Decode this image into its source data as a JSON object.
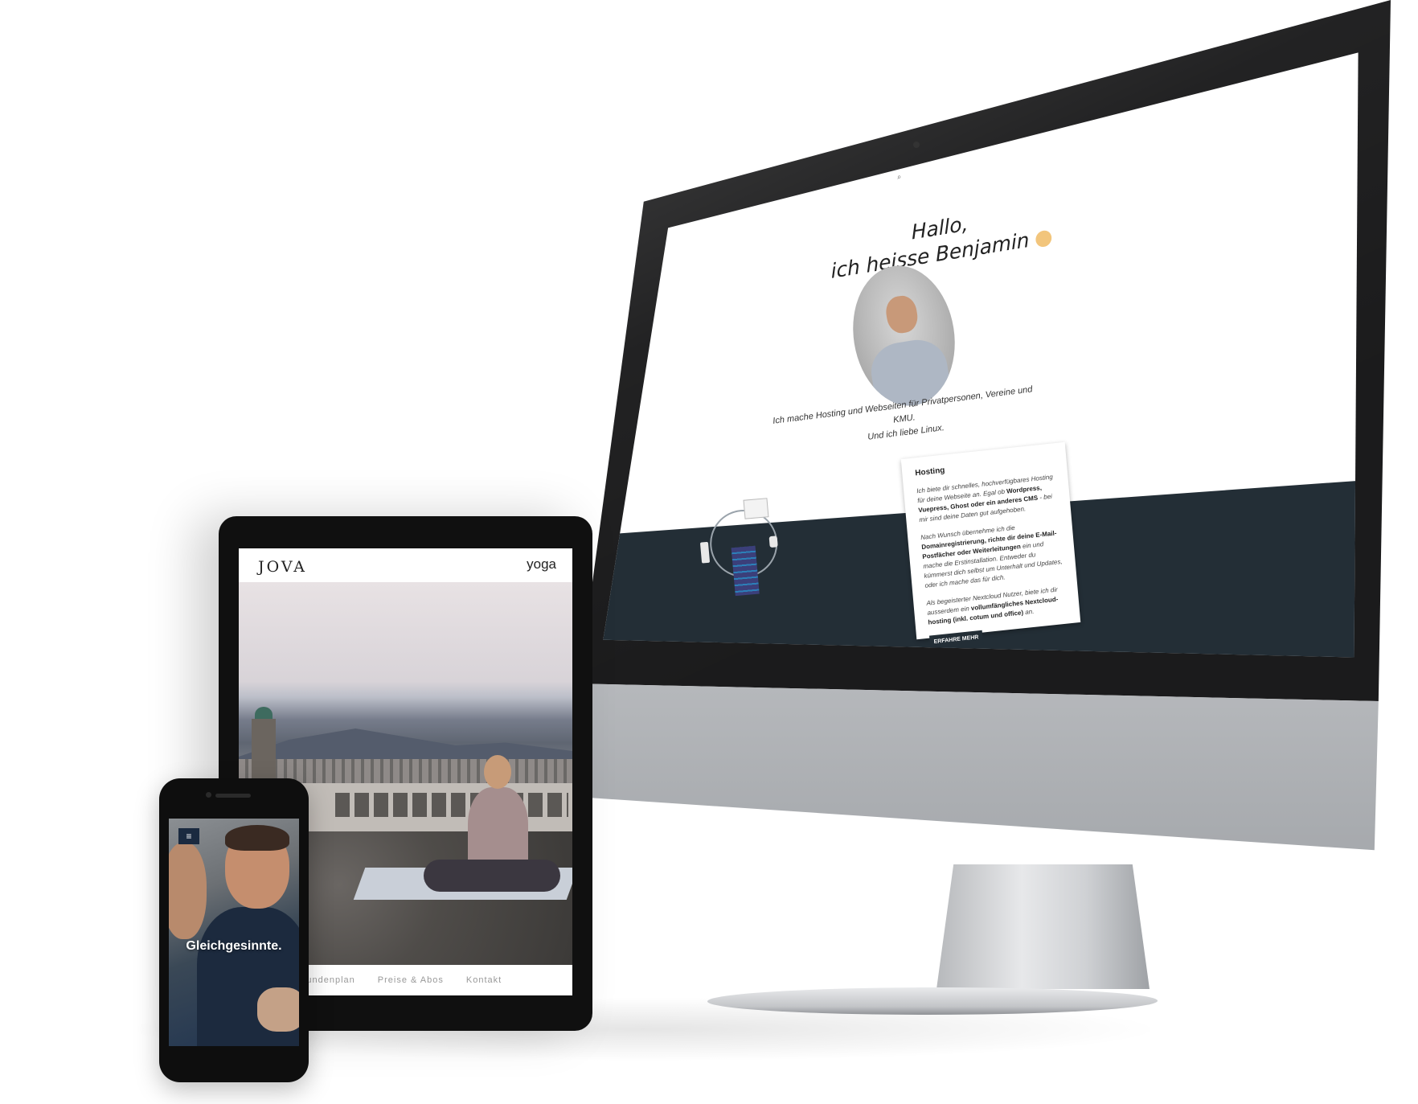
{
  "desktop": {
    "logo": "<bk/>",
    "menu_icon": "more-vertical-icon",
    "social_icons": [
      "github-icon",
      "twitter-icon"
    ],
    "search_icon": "search-icon",
    "heading_line1": "Hallo,",
    "heading_line2": "ich heisse Benjamin",
    "wave_icon": "waving-hand-icon",
    "intro_line1": "Ich mache Hosting und Webseiten für Privatpersonen, Vereine und KMU.",
    "intro_line2": "Und ich liebe Linux.",
    "card": {
      "title": "Hosting",
      "para1_pre": "Ich biete dir schnelles, hochverfügbares Hosting für deine Webseite an. Egal ob ",
      "para1_bold": "Wordpress, Vuepress, Ghost oder ein anderes CMS",
      "para1_post": " - bei mir sind deine Daten gut aufgehoben.",
      "para2_pre": "Nach Wunsch übernehme ich die ",
      "para2_bold1": "Domainregistrierung, richte dir deine E-Mail-Postfächer oder Weiterleitungen",
      "para2_post": " ein und mache die Erstinstallation. Entweder du kümmerst dich selbst um Unterhalt und Updates, oder ich mache das für dich.",
      "para3_pre": "Als begeisterter Nextcloud Nutzer, biete ich dir ausserdem ein ",
      "para3_bold": "vollumfängliches Nextcloud-hosting (inkl. cotum und office)",
      "para3_post": " an.",
      "button": "ERFAHRE MEHR"
    },
    "colors": {
      "dark": "#232e36"
    }
  },
  "tablet": {
    "logo": "JOVA",
    "brand_right": "yoga",
    "nav": [
      "Stundenplan",
      "Preise & Abos",
      "Kontakt"
    ]
  },
  "phone": {
    "menu_icon": "hamburger-menu-icon",
    "menu_glyph": "≡",
    "title": "Gleichgesinnte."
  }
}
